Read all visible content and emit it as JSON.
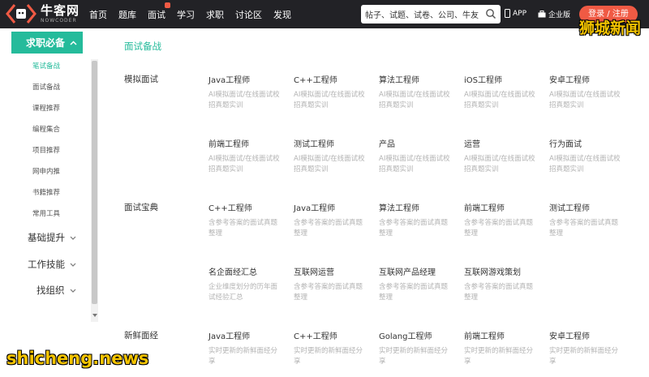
{
  "brand": {
    "name": "牛客网",
    "sub": "NOWCODER"
  },
  "nav": [
    "首页",
    "题库",
    "面试",
    "学习",
    "求职",
    "讨论区",
    "发现"
  ],
  "search": {
    "text": "帖子、试题、试卷、公司、牛友"
  },
  "header": {
    "app": "APP",
    "biz": "企业版",
    "login": "登录 / 注册"
  },
  "watermarks": {
    "top": "狮城新闻",
    "bottom": "shicheng.news"
  },
  "sidebar": {
    "active_group": "求职必备",
    "sub_items": [
      "笔试备战",
      "面试备战",
      "课程推荐",
      "编程集合",
      "项目推荐",
      "网申内推",
      "书籍推荐",
      "常用工具"
    ],
    "groups": [
      "基础提升",
      "工作技能",
      "找组织"
    ]
  },
  "main": {
    "title": "面试备战",
    "sections": [
      {
        "label": "模拟面试",
        "cards": [
          {
            "title": "Java工程师",
            "desc": "AI模拟面试/在线面试校招真题实训"
          },
          {
            "title": "C++工程师",
            "desc": "AI模拟面试/在线面试校招真题实训"
          },
          {
            "title": "算法工程师",
            "desc": "AI模拟面试/在线面试校招真题实训"
          },
          {
            "title": "iOS工程师",
            "desc": "AI模拟面试/在线面试校招真题实训"
          },
          {
            "title": "安卓工程师",
            "desc": "AI模拟面试/在线面试校招真题实训"
          },
          {
            "title": "前端工程师",
            "desc": "AI模拟面试/在线面试校招真题实训"
          },
          {
            "title": "测试工程师",
            "desc": "AI模拟面试/在线面试校招真题实训"
          },
          {
            "title": "产品",
            "desc": "AI模拟面试/在线面试校招真题实训"
          },
          {
            "title": "运营",
            "desc": "AI模拟面试/在线面试校招真题实训"
          },
          {
            "title": "行为面试",
            "desc": "AI模拟面试/在线面试校招真题实训"
          }
        ]
      },
      {
        "label": "面试宝典",
        "cards": [
          {
            "title": "C++工程师",
            "desc": "含参考答案的面试真题整理"
          },
          {
            "title": "Java工程师",
            "desc": "含参考答案的面试真题整理"
          },
          {
            "title": "算法工程师",
            "desc": "含参考答案的面试真题整理"
          },
          {
            "title": "前端工程师",
            "desc": "含参考答案的面试真题整理"
          },
          {
            "title": "测试工程师",
            "desc": "含参考答案的面试真题整理"
          },
          {
            "title": "名企面经汇总",
            "desc": "企业维度划分的历年面试经验汇总"
          },
          {
            "title": "互联网运营",
            "desc": "含参考答案的面试真题整理"
          },
          {
            "title": "互联网产品经理",
            "desc": "含参考答案的面试真题整理"
          },
          {
            "title": "互联网游戏策划",
            "desc": "含参考答案的面试真题整理"
          }
        ]
      },
      {
        "label": "新鲜面经",
        "cards": [
          {
            "title": "Java工程师",
            "desc": "实时更新的新鲜面经分享"
          },
          {
            "title": "C++工程师",
            "desc": "实时更新的新鲜面经分享"
          },
          {
            "title": "Golang工程师",
            "desc": "实时更新的新鲜面经分享"
          },
          {
            "title": "前端工程师",
            "desc": "实时更新的新鲜面经分享"
          },
          {
            "title": "安卓工程师",
            "desc": "实时更新的新鲜面经分享"
          }
        ]
      }
    ]
  },
  "colors": {
    "accent": "#25bb9b",
    "topbar": "#222226",
    "login": "#f05a44"
  }
}
